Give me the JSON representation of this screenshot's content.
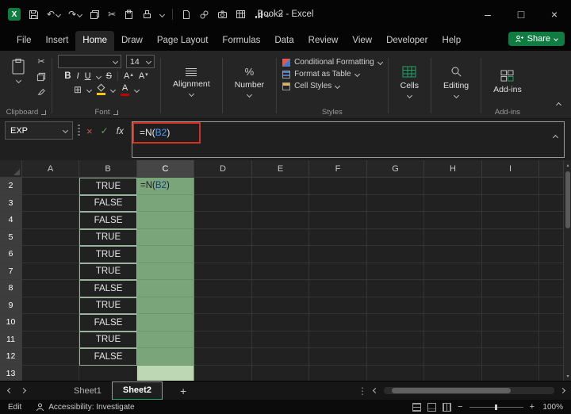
{
  "titlebar": {
    "title": "Book2 - Excel"
  },
  "icons": {
    "logo": "X",
    "undo": "↶",
    "redo": "↷",
    "cut": "✂",
    "overflow": "»",
    "minimize": "–",
    "maximize": "□",
    "close": "×",
    "cancel": "×",
    "enter": "✓",
    "fx": "fx",
    "borders": "⊞",
    "percent": "%",
    "more": "⋮",
    "add": "+",
    "up": "▴",
    "down": "▾"
  },
  "tabs": {
    "items": [
      "File",
      "Insert",
      "Home",
      "Draw",
      "Page Layout",
      "Formulas",
      "Data",
      "Review",
      "View",
      "Developer",
      "Help"
    ],
    "active": "Home",
    "share_label": "Share"
  },
  "ribbon": {
    "groups": {
      "clipboard": "Clipboard",
      "font": "Font",
      "styles": "Styles",
      "addins": "Add-ins"
    },
    "font_size": "14",
    "font_tokens": {
      "bold": "B",
      "italic": "I",
      "underline": "U",
      "strike": "S",
      "grow": "A",
      "shrink": "A",
      "color": "A"
    },
    "styles_items": [
      "Conditional Formatting",
      "Format as Table",
      "Cell Styles"
    ],
    "buttons": {
      "alignment": "Alignment",
      "number": "Number",
      "cells": "Cells",
      "editing": "Editing",
      "addins": "Add-ins"
    }
  },
  "formula_bar": {
    "name_box": "EXP",
    "prefix": "=N(",
    "ref": "B2",
    "suffix": ")"
  },
  "grid": {
    "col_headers": [
      "A",
      "B",
      "C",
      "D",
      "E",
      "F",
      "G",
      "H",
      "I"
    ],
    "selected_column": "C",
    "row_headers": [
      "2",
      "3",
      "4",
      "5",
      "6",
      "7",
      "8",
      "9",
      "10",
      "11",
      "12",
      "13"
    ],
    "b_values": [
      "TRUE",
      "FALSE",
      "FALSE",
      "TRUE",
      "TRUE",
      "TRUE",
      "FALSE",
      "TRUE",
      "FALSE",
      "TRUE",
      "FALSE"
    ],
    "c2_prefix": "=N(",
    "c2_ref": "B2",
    "c2_suffix": ")"
  },
  "sheets": {
    "tabs": [
      "Sheet1",
      "Sheet2"
    ],
    "active": "Sheet2",
    "add_label": "+"
  },
  "status": {
    "mode": "Edit",
    "accessibility": "Accessibility: Investigate",
    "zoom": "100%"
  }
}
